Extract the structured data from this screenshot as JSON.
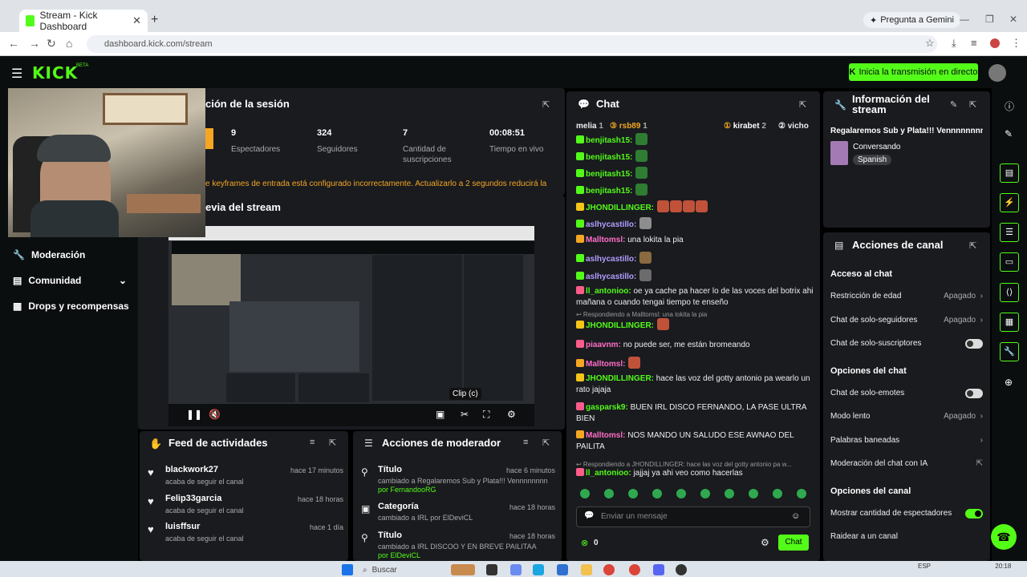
{
  "browser": {
    "tab_title": "Stream - Kick Dashboard",
    "url": "dashboard.kick.com/stream",
    "gemini_label": "Pregunta a Gemini"
  },
  "header": {
    "logo": "KICK",
    "beta": "BETA",
    "golive_label": "Inicia la transmisión en directo"
  },
  "sidebar": {
    "items": [
      {
        "label": "Moderación"
      },
      {
        "label": "Comunidad"
      },
      {
        "label": "Drops y recompensas"
      }
    ]
  },
  "session": {
    "title": "ción de la sesión",
    "stats": [
      {
        "value": "9",
        "label": "Espectadores"
      },
      {
        "value": "324",
        "label": "Seguidores"
      },
      {
        "value": "7",
        "label": "Cantidad de suscripciones"
      },
      {
        "value": "00:08:51",
        "label": "Tiempo en vivo"
      }
    ],
    "warning": "e keyframes de entrada está configurado incorrectamente. Actualizarlo a 2 segundos reducirá la"
  },
  "preview": {
    "title": "evia del stream",
    "clip_tooltip": "Clip (c)"
  },
  "feed": {
    "title": "Feed de actividades",
    "items": [
      {
        "name": "blackwork27",
        "time": "hace 17 minutos",
        "sub": "acaba de seguir el canal"
      },
      {
        "name": "Felip33garcia",
        "time": "hace 18 horas",
        "sub": "acaba de seguir el canal"
      },
      {
        "name": "luisffsur",
        "time": "hace 1 día",
        "sub": "acaba de seguir el canal"
      }
    ]
  },
  "modactions": {
    "title": "Acciones de moderador",
    "items": [
      {
        "name": "Título",
        "time": "hace 6 minutos",
        "line1": "cambiado a Regalaremos Sub y Plata!!! Vennnnnnnn",
        "line2": "por FernandooRG"
      },
      {
        "name": "Categoría",
        "time": "hace 18 horas",
        "line1": "cambiado a IRL por ElDeviCL",
        "line2": ""
      },
      {
        "name": "Título",
        "time": "hace 18 horas",
        "line1": "cambiado a IRL DISCOO Y EN BREVE PAILITAA",
        "line2": "por ElDeviCL"
      }
    ]
  },
  "chat": {
    "title": "Chat",
    "top_chatters": [
      {
        "name": "melia",
        "count": "1"
      },
      {
        "name": "rsb89",
        "count": "1"
      },
      {
        "name": "kirabet",
        "count": "2"
      },
      {
        "name": "vicho",
        "count": ""
      }
    ],
    "messages": [
      {
        "user": "benjitash15:",
        "color": "#53fc18",
        "text": ""
      },
      {
        "user": "benjitash15:",
        "color": "#53fc18",
        "text": ""
      },
      {
        "user": "benjitash15:",
        "color": "#53fc18",
        "text": ""
      },
      {
        "user": "benjitash15:",
        "color": "#53fc18",
        "text": ""
      },
      {
        "user": "JHONDILLINGER:",
        "color": "#53fc18",
        "text": ""
      },
      {
        "user": "aslhycastillo:",
        "color": "#b39dff",
        "text": ""
      },
      {
        "user": "Malltomsl:",
        "color": "#ff6ec7",
        "text": "una lokita la pia"
      },
      {
        "user": "aslhycastillo:",
        "color": "#b39dff",
        "text": ""
      },
      {
        "user": "aslhycastillo:",
        "color": "#b39dff",
        "text": ""
      },
      {
        "user": "ll_antonioo:",
        "color": "#53fc18",
        "text": "oe ya cache pa hacer lo de las voces del botrix ahi mañana o cuando tengai tiempo te enseño"
      },
      {
        "user": "JHONDILLINGER:",
        "color": "#53fc18",
        "text": "",
        "reply": "Respondiendo a Malltomsl: una lokita la pia"
      },
      {
        "user": "piaavnm:",
        "color": "#ff6ec7",
        "text": "no puede ser, me están bromeando"
      },
      {
        "user": "Malltomsl:",
        "color": "#ff6ec7",
        "text": ""
      },
      {
        "user": "JHONDILLINGER:",
        "color": "#53fc18",
        "text": "hace las voz del gotty antonio pa wearlo un rato jajaja"
      },
      {
        "user": "gasparsk9:",
        "color": "#53fc18",
        "text": "BUEN IRL DISCO FERNANDO, LA PASE ULTRA BIEN"
      },
      {
        "user": "Malltomsl:",
        "color": "#ff6ec7",
        "text": "NOS MANDO UN SALUDO ESE AWNAO DEL PAILITA"
      },
      {
        "user": "ll_antonioo:",
        "color": "#53fc18",
        "text": "jajjaj ya ahi veo como hacerlas",
        "reply": "Respondiendo a JHONDILLINGER: hace las voz del gotty antonio pa w..."
      }
    ],
    "input_placeholder": "Enviar un mensaje",
    "send_label": "Chat",
    "points": "0"
  },
  "streaminfo": {
    "title": "Información del stream",
    "stream_title": "Regalaremos Sub y Plata!!! Vennnnnnnnn",
    "category": "Conversando",
    "language": "Spanish"
  },
  "actions": {
    "title": "Acciones de canal",
    "section1": "Acceso al chat",
    "opts1": [
      {
        "label": "Restricción de edad",
        "value": "Apagado"
      },
      {
        "label": "Chat de solo-seguidores",
        "value": "Apagado"
      },
      {
        "label": "Chat de solo-suscriptores",
        "value": ""
      }
    ],
    "section2": "Opciones del chat",
    "opts2": [
      {
        "label": "Chat de solo-emotes",
        "value": ""
      },
      {
        "label": "Modo lento",
        "value": "Apagado"
      },
      {
        "label": "Palabras baneadas",
        "value": ""
      },
      {
        "label": "Moderación del chat con IA",
        "value": ""
      }
    ],
    "section3": "Opciones del canal",
    "opts3": [
      {
        "label": "Mostrar cantidad de espectadores",
        "value": ""
      },
      {
        "label": "Raidear a un canal",
        "value": ""
      }
    ]
  },
  "taskbar": {
    "search": "Buscar",
    "lang": "ESP",
    "time": "20:18"
  }
}
